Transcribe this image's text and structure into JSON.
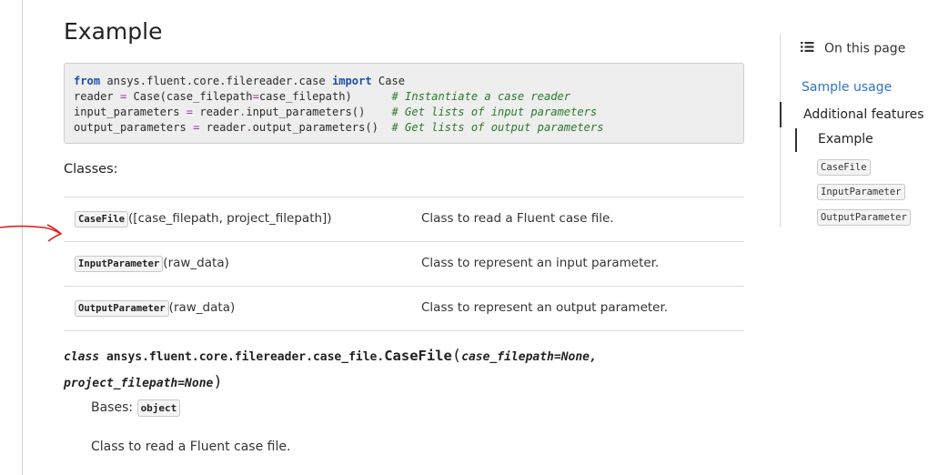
{
  "title": "Example",
  "code": {
    "line1": {
      "kw1": "from",
      "mod": " ansys.fluent.core.filereader.case ",
      "kw2": "import",
      "rest": " Case"
    },
    "line2": {
      "a": "reader ",
      "eq": "=",
      "b": " Case(case_filepath",
      "eq2": "=",
      "c": "case_filepath)      ",
      "comment": "# Instantiate a case reader"
    },
    "line3": {
      "a": "input_parameters ",
      "eq": "=",
      "b": " reader",
      "dot": ".",
      "c": "input_parameters()    ",
      "comment": "# Get lists of input parameters"
    },
    "line4": {
      "a": "output_parameters ",
      "eq": "=",
      "b": " reader",
      "dot": ".",
      "c": "output_parameters()  ",
      "comment": "# Get lists of output parameters"
    }
  },
  "classes_heading": "Classes:",
  "classes": [
    {
      "name": "CaseFile",
      "args": "([case_filepath, project_filepath])",
      "desc": "Class to read a Fluent case file."
    },
    {
      "name": "InputParameter",
      "args": "(raw_data)",
      "desc": "Class to represent an input parameter."
    },
    {
      "name": "OutputParameter",
      "args": "(raw_data)",
      "desc": "Class to represent an output parameter."
    }
  ],
  "signature": {
    "prefix": "class",
    "module": " ansys.fluent.core.filereader.case_file.",
    "name": "CaseFile",
    "open": "(",
    "param1": "case_filepath=None,",
    "param2": "project_filepath=None",
    "close": ")"
  },
  "bases_label": "Bases:",
  "bases_value": "object",
  "class_doc": "Class to read a Fluent case file.",
  "toc": {
    "header": "On this page",
    "icon": "list-icon",
    "items": [
      {
        "label": "Sample usage"
      },
      {
        "label": "Additional features"
      },
      {
        "label": "Example"
      }
    ],
    "code_items": [
      "CaseFile",
      "InputParameter",
      "OutputParameter"
    ]
  },
  "colors": {
    "link": "#2e74c4",
    "keyword": "#1f4fa8",
    "comment": "#2a7a2a",
    "annotation": "#e02020"
  }
}
